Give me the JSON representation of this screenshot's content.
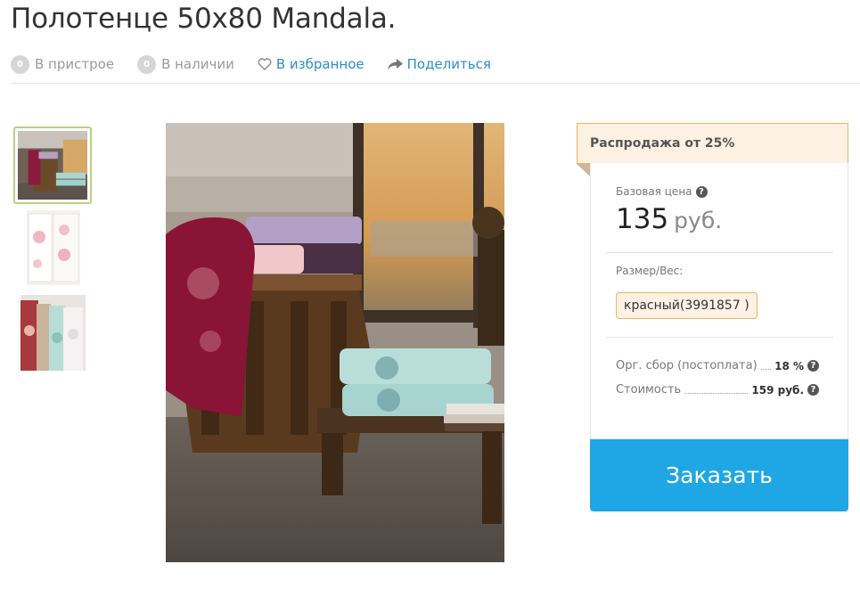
{
  "product": {
    "title": "Полотенце 50x80 Mandala."
  },
  "meta": {
    "pristroy_count": "0",
    "pristroy_label": "В пристрое",
    "stock_count": "0",
    "stock_label": "В наличии",
    "favorite_label": "В избранное",
    "share_label": "Поделиться"
  },
  "pricing": {
    "sale_banner": "Распродажа от 25%",
    "base_price_label": "Базовая цена",
    "price_value": "135",
    "price_currency": "руб.",
    "size_label": "Размер/Вес:",
    "size_option": "красный(3991857 )",
    "org_fee_label": "Орг. сбор (постоплата)",
    "org_fee_value": "18 %",
    "total_label": "Стоимость",
    "total_value": "159 руб.",
    "order_button": "Заказать"
  },
  "colors": {
    "accent": "#1ea7e4",
    "link": "#2a8fc7",
    "sale_border": "#e8b75e",
    "sale_bg": "#fdf1e3",
    "thumb_active": "#b6d37c"
  },
  "icons": {
    "heart": "heart-icon",
    "share": "share-arrow-icon",
    "help": "question-icon"
  }
}
